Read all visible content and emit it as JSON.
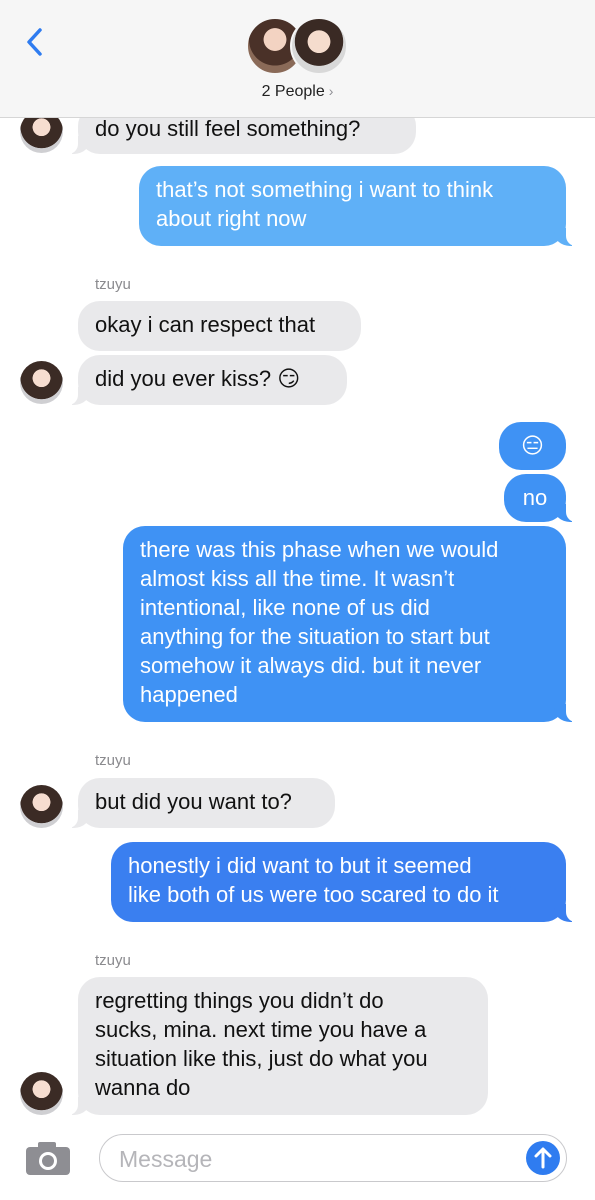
{
  "header": {
    "title": "2 People",
    "chevron": "›",
    "icons": {
      "back": "back-chevron-icon"
    }
  },
  "messages": [
    {
      "text": "do you still feel something?"
    },
    {
      "text": "that’s not something i want to think\nabout right now"
    },
    {
      "sender": "tzuyu"
    },
    {
      "text": "okay i can respect that"
    },
    {
      "text": "did you ever kiss? 😏"
    },
    {
      "text": "😑"
    },
    {
      "text": "no"
    },
    {
      "text": "there was this phase when we would\nalmost kiss all the time. It wasn’t\nintentional, like none of us did\nanything for the situation to start but\nsomehow it always did. but it never\nhappened"
    },
    {
      "sender": "tzuyu"
    },
    {
      "text": "but did you want to?"
    },
    {
      "text": "honestly i did want to but it seemed\nlike both of us were too scared to do it"
    },
    {
      "sender": "tzuyu"
    },
    {
      "text": "regretting things you didn’t do\nsucks, mina. next time you have a\nsituation like this, just do what you\nwanna do"
    }
  ],
  "input": {
    "placeholder": "Message"
  },
  "colors": {
    "incoming": "#e9e9eb",
    "outgoing_light": "#5fb0f7",
    "outgoing_mid": "#3f92f4",
    "outgoing_dark": "#3a7ff0",
    "accent": "#2f7cf0"
  }
}
